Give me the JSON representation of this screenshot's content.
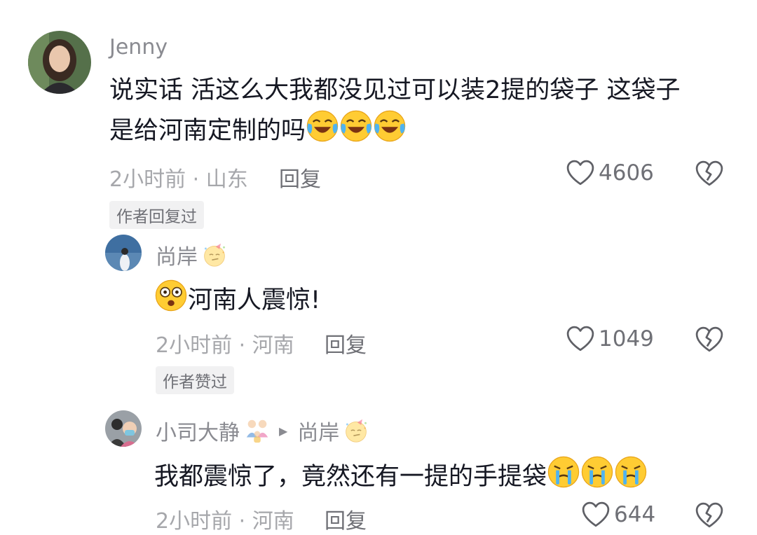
{
  "comments": [
    {
      "username": "Jenny",
      "text_line1": "说实话 活这么大我都没见过可以装2提的袋子 这袋子",
      "text_line2": "是给河南定制的吗",
      "text_emojis": [
        "laugh-cry-emoji",
        "laugh-cry-emoji",
        "laugh-cry-emoji"
      ],
      "meta": "2小时前 · 山东",
      "reply_label": "回复",
      "like_count": "4606",
      "badge": "作者回复过"
    },
    {
      "username": "尚岸",
      "username_emoji": "party-face-emoji",
      "text_prefix_emoji": "shocked-face-emoji",
      "text": "河南人震惊!",
      "meta": "2小时前 · 河南",
      "reply_label": "回复",
      "like_count": "1049",
      "badge": "作者赞过"
    },
    {
      "username": "小司大静",
      "username_emoji": "family-emoji",
      "reply_to": "尚岸",
      "reply_to_emoji": "party-face-emoji",
      "text": "我都震惊了，竟然还有一提的手提袋",
      "text_emojis": [
        "crying-face-emoji",
        "crying-face-emoji",
        "crying-face-emoji"
      ],
      "meta": "2小时前 · 河南",
      "reply_label": "回复",
      "like_count": "644"
    }
  ]
}
